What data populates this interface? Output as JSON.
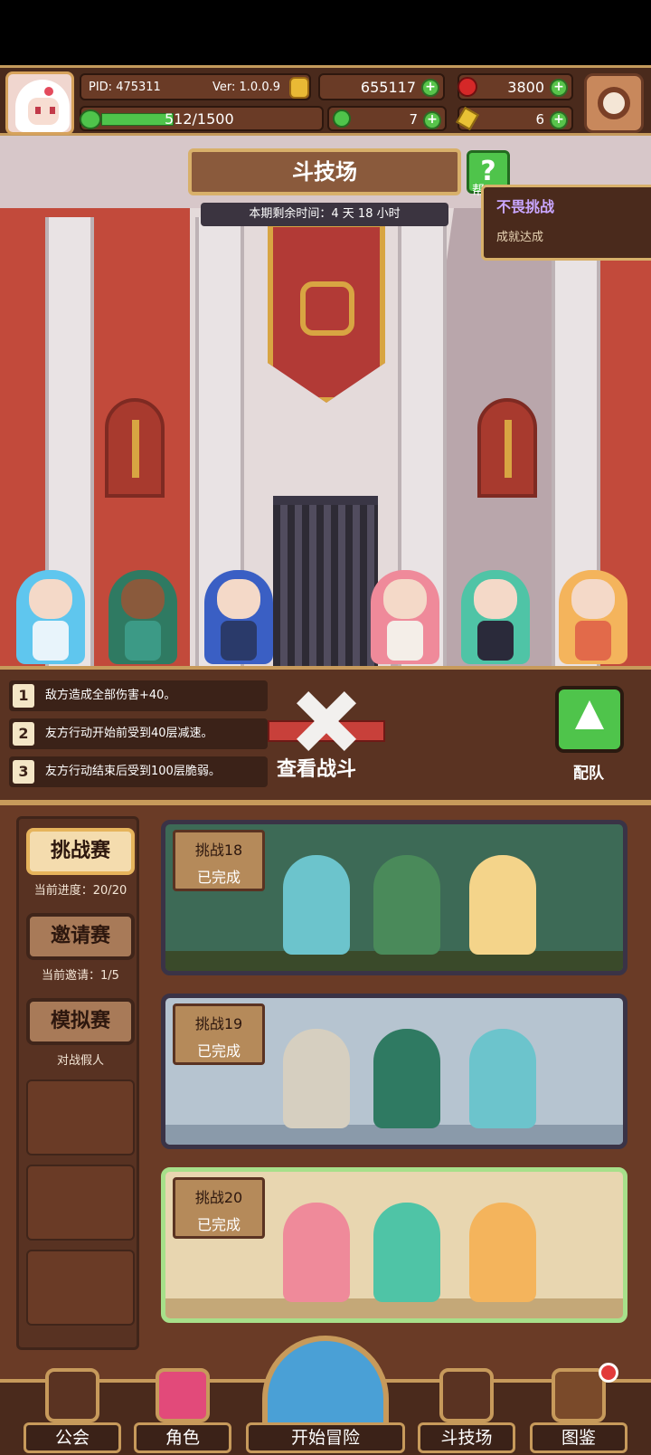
{
  "header": {
    "pid": "PID: 475311",
    "version": "Ver: 1.0.0.9",
    "gold": "655117",
    "gems": "3800",
    "stamina": "512/1500",
    "clover": "7",
    "key": "6"
  },
  "arena": {
    "title": "斗技场",
    "help_label": "帮",
    "time_remaining": "本期剩余时间：4 天 18 小时",
    "achievement_title": "不畏挑战",
    "achievement_sub": "成就达成"
  },
  "rules": [
    "敌方造成全部伤害+40。",
    "友方行动开始前受到40层减速。",
    "友方行动结束后受到100层脆弱。"
  ],
  "rule_nums": [
    "1",
    "2",
    "3"
  ],
  "watch_battle": "查看战斗",
  "team_label": "配队",
  "sidebar": {
    "challenge": "挑战赛",
    "challenge_progress": "当前进度：20/20",
    "invite": "邀请赛",
    "invite_progress": "当前邀请：1/5",
    "sim": "模拟赛",
    "sim_sub": "对战假人"
  },
  "challenges": [
    {
      "name": "挑战18",
      "status": "已完成"
    },
    {
      "name": "挑战19",
      "status": "已完成"
    },
    {
      "name": "挑战20",
      "status": "已完成"
    }
  ],
  "nav": {
    "guild": "公会",
    "role": "角色",
    "adventure": "开始冒险",
    "arena": "斗技场",
    "codex": "图鉴"
  },
  "colors": {
    "gold_trim": "#c79a5b",
    "wood": "#6a3b26",
    "green": "#4fc44b",
    "red_wall": "#c24a3b"
  }
}
